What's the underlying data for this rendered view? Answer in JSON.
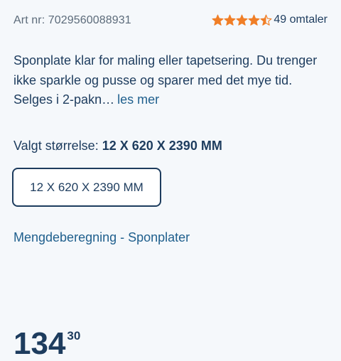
{
  "product": {
    "art_nr_label": "Art nr: 7029560088931",
    "rating_value": 4.5,
    "rating_max": 5,
    "star_color": "#f07e26",
    "reviews_label": "49 omtaler",
    "description": "Sponplate klar for maling eller tapetsering. Du trenger ikke sparkle og pusse og sparer med det mye tid. Selges i 2-pakn…",
    "read_more_label": "les mer"
  },
  "size": {
    "label": "Valgt størrelse:",
    "selected": "12 X 620 X 2390 MM",
    "options": [
      "12 X 620 X 2390 MM"
    ]
  },
  "calculator_link": "Mengdeberegning - Sponplater",
  "price": {
    "main": "134",
    "decimals": "30"
  }
}
